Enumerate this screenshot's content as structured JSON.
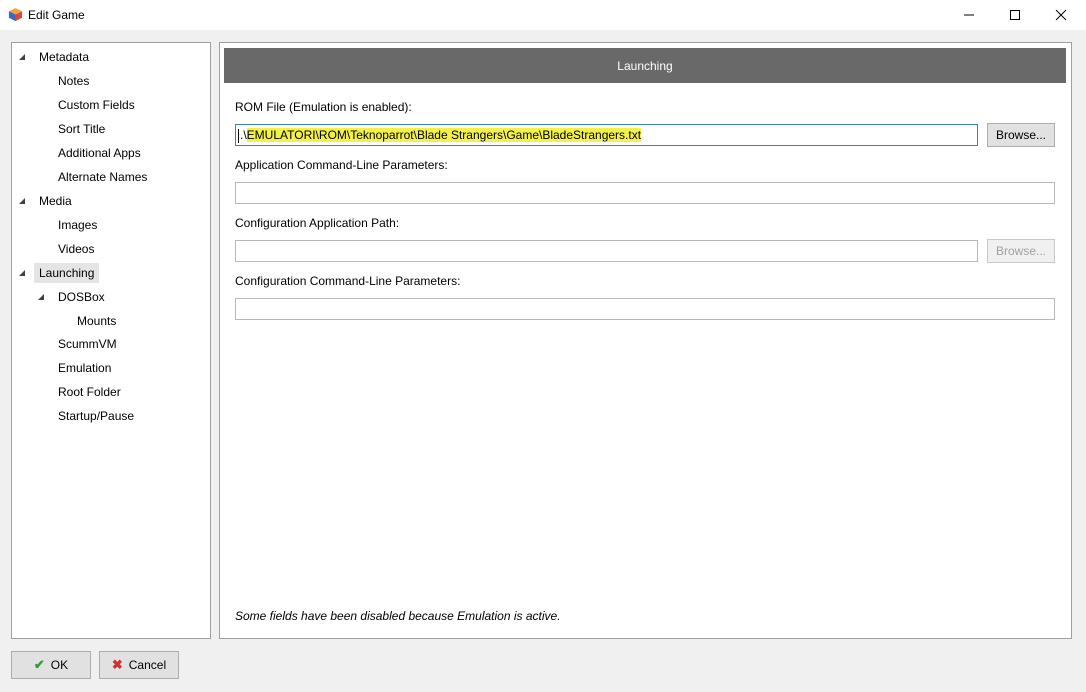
{
  "window": {
    "title": "Edit Game"
  },
  "tree": {
    "metadata": "Metadata",
    "notes": "Notes",
    "custom_fields": "Custom Fields",
    "sort_title": "Sort Title",
    "additional_apps": "Additional Apps",
    "alternate_names": "Alternate Names",
    "media": "Media",
    "images": "Images",
    "videos": "Videos",
    "launching": "Launching",
    "dosbox": "DOSBox",
    "mounts": "Mounts",
    "scummvm": "ScummVM",
    "emulation": "Emulation",
    "root_folder": "Root Folder",
    "startup_pause": "Startup/Pause"
  },
  "main": {
    "header": "Launching",
    "rom_label": "ROM File (Emulation is enabled):",
    "rom_prefix": ".\\",
    "rom_value": "EMULATORI\\ROM\\Teknoparrot\\Blade Strangers\\Game\\BladeStrangers.txt",
    "browse_label": "Browse...",
    "app_params_label": "Application Command-Line Parameters:",
    "config_path_label": "Configuration Application Path:",
    "config_params_label": "Configuration Command-Line Parameters:",
    "note": "Some fields have been disabled because Emulation is active."
  },
  "buttons": {
    "ok": "OK",
    "cancel": "Cancel"
  },
  "colors": {
    "header_bg": "#696969",
    "highlight": "#f4f04a",
    "ok_check": "#3a9a3a",
    "cancel_x": "#d03030"
  }
}
